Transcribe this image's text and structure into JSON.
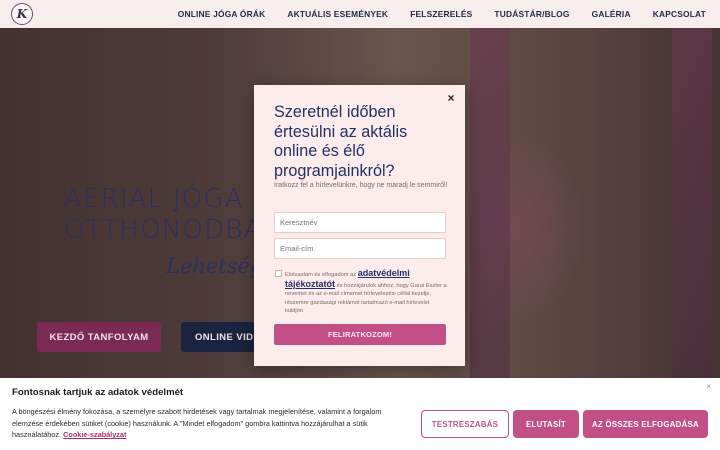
{
  "header": {
    "logo_letter": "K",
    "nav": [
      "ONLINE JÓGA ÓRÁK",
      "AKTUÁLIS ESEMÉNYEK",
      "FELSZERELÉS",
      "TUDÁSTÁR/BLOG",
      "GALÉRIA",
      "KAPCSOLAT"
    ]
  },
  "hero": {
    "title_line1": "AERIAL JÓGA A",
    "title_line2": "OTTHONODBAN",
    "script": "Lehetség",
    "course_button": "KEZDŐ TANFOLYAM",
    "video_button": "ONLINE VIDEÓ"
  },
  "modal": {
    "close": "×",
    "heading": "Szeretnél időben értesülni az aktális online és élő programjainkról?",
    "subtitle": "Iratkozz fel a hírlevelünkre, hogy ne maradj le semmiről!",
    "name_placeholder": "Keresztnév",
    "email_placeholder": "Email-cím",
    "consent_before": "Elolvastam és elfogadom az ",
    "consent_link": "adatvédelmi tájékoztatót",
    "consent_after": " és hozzájárulok ahhoz, hogy Garai Eszter a nevemet és az e-mail címemet hírlevelezési céllal kezelje, részemre gazdasági reklámot tartalmazó e-mail hírlevelet küldjön",
    "submit": "FELIRATKOZOM!"
  },
  "cookie": {
    "close": "×",
    "title": "Fontosnak tartjuk az adatok védelmét",
    "text": "A böngészési élmény fokozása, a személyre szabott hirdetések vagy tartalmak megjelenítése, valamint a forgalom elemzése érdekében sütiket (cookie) használunk. A \"Mindet elfogadom\" gombra kattintva hozzájárulhat a sütik használatához.",
    "policy_link": "Cookie-szabályzat",
    "customize": "TESTRESZABÁS",
    "reject": "ELUTASÍT",
    "accept": "AZ ÖSSZES ELFOGADÁSA"
  },
  "colors": {
    "accent": "#c34f87",
    "navy": "#233066",
    "modal_bg": "#fcecec"
  }
}
